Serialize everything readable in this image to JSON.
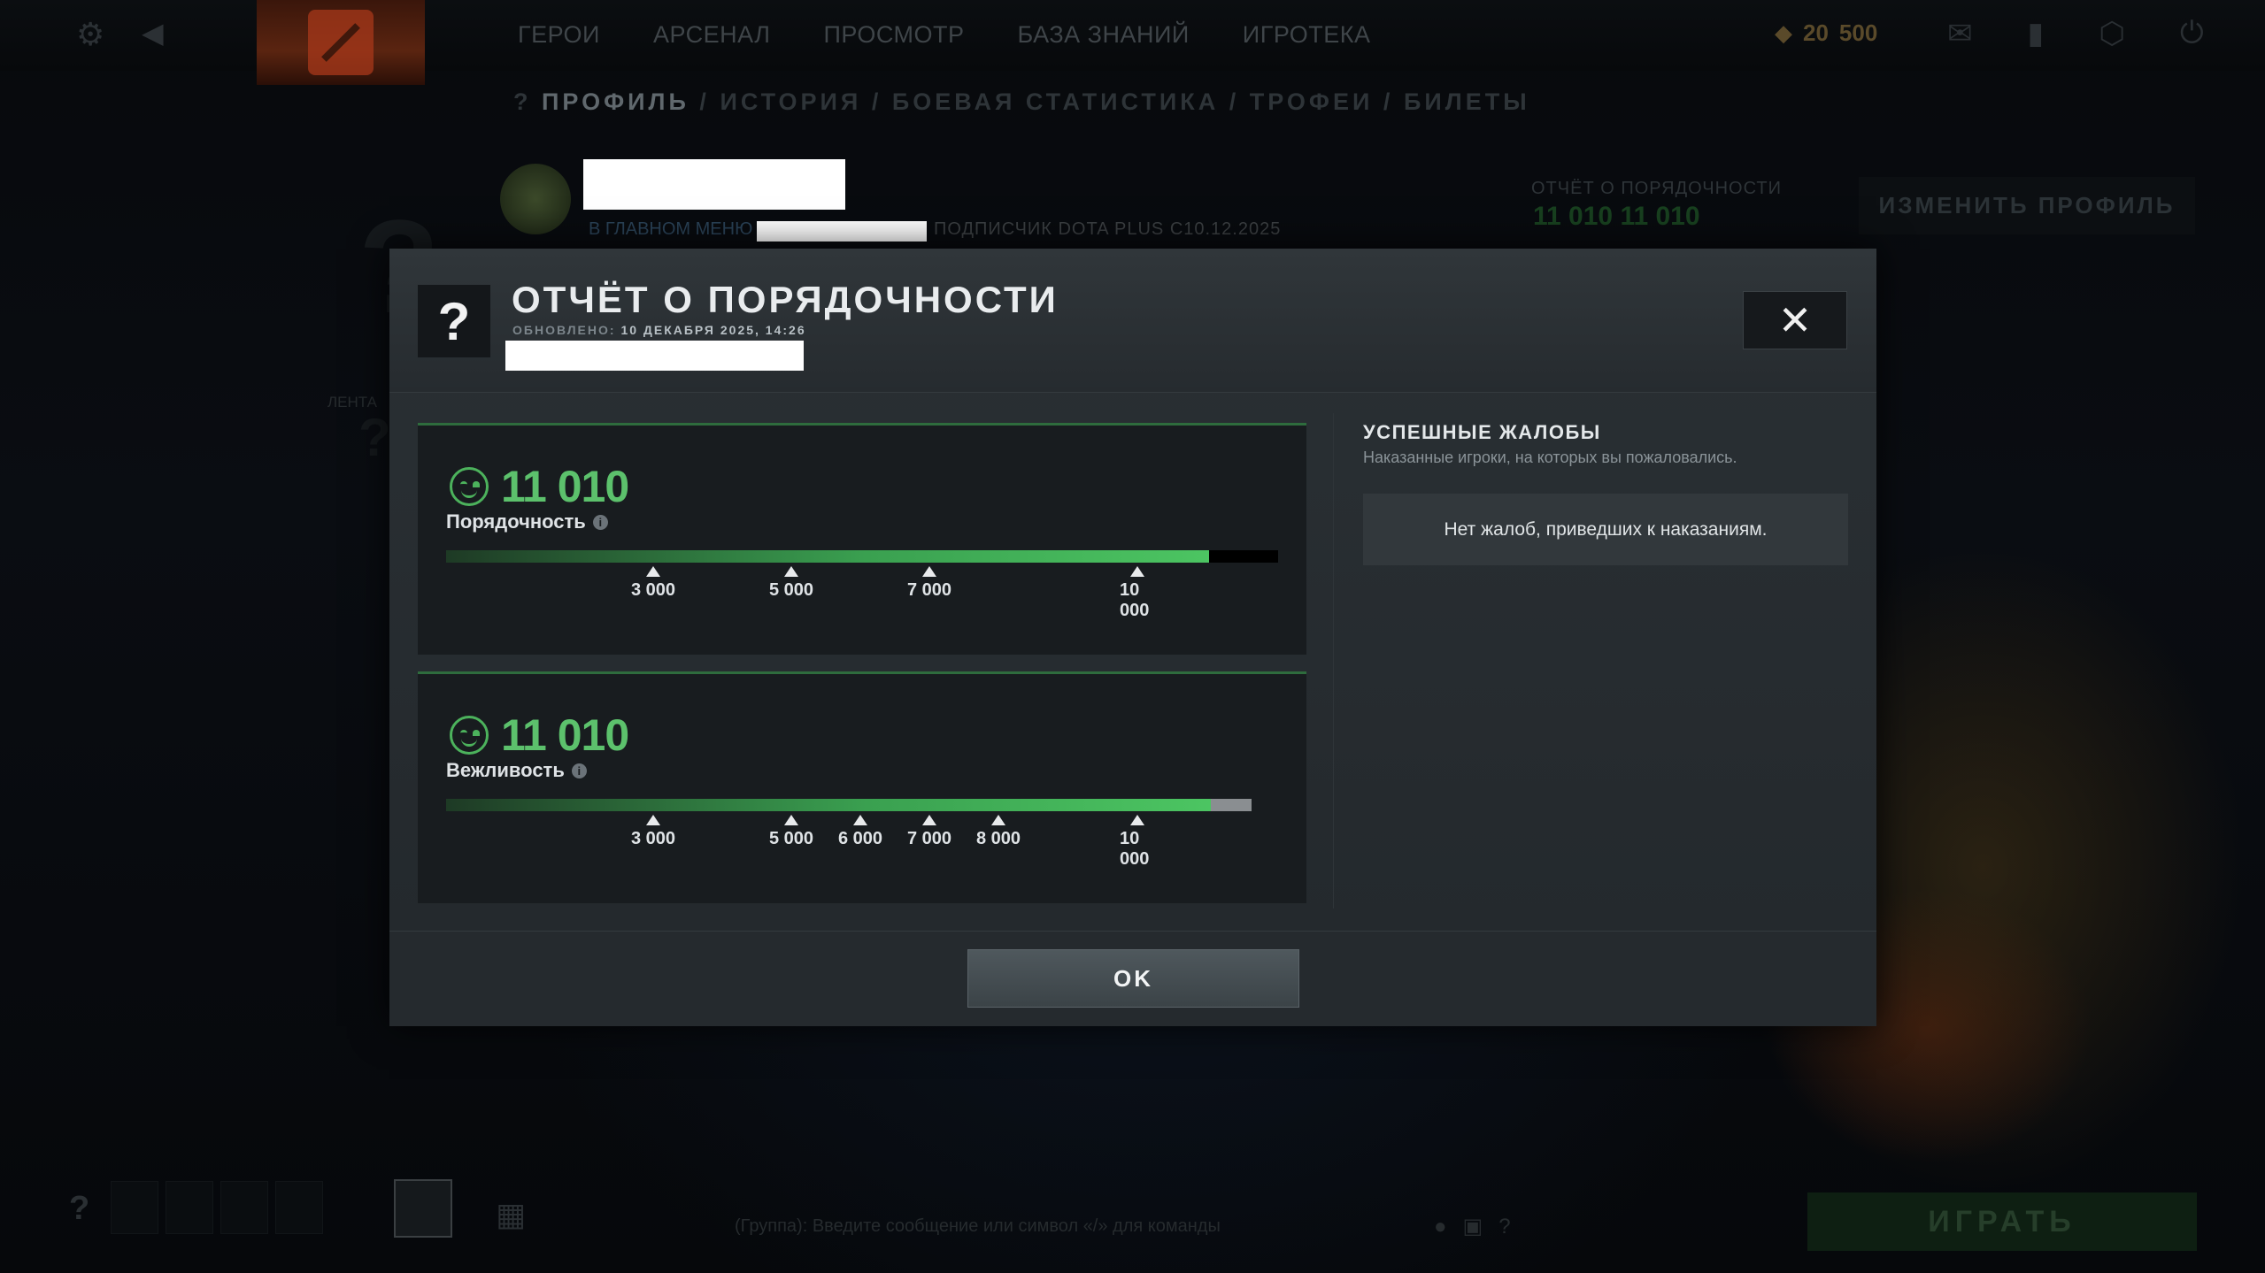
{
  "topbar": {
    "nav": [
      "ГЕРОИ",
      "АРСЕНАЛ",
      "ПРОСМОТР",
      "БАЗА ЗНАНИЙ",
      "ИГРОТЕКА"
    ],
    "currency_1": "20",
    "currency_2": "500"
  },
  "subnav": {
    "help": "?",
    "profile": "ПРОФИЛЬ",
    "history": "ИСТОРИЯ",
    "stats": "БОЕВАЯ СТАТИСТИКА",
    "trophies": "ТРОФЕИ",
    "tickets": "БИЛЕТЫ"
  },
  "profile": {
    "status": "В ГЛАВНОМ МЕНЮ",
    "subscription": "ПОДПИСЧИК DOTA PLUS",
    "since": "С10.12.2025",
    "conduct_label": "ОТЧЁТ О ПОРЯДОЧНОСТИ",
    "conduct_val_1": "11 010",
    "conduct_val_2": "11 010",
    "edit_button": "ИЗМЕНИТЬ ПРОФИЛЬ",
    "feed_label": "ЛЕНТА"
  },
  "modal": {
    "icon": "?",
    "title": "ОТЧЁТ О ПОРЯДОЧНОСТИ",
    "updated_label": "ОБНОВЛЕНО:",
    "updated_value": "10 ДЕКАБРЯ 2025, 14:26",
    "close": "✕",
    "ok_button": "OK"
  },
  "behavior": {
    "score": "11 010",
    "label": "Порядочность",
    "fill": 0.917,
    "track_color": "#000000",
    "ticks": [
      "3 000",
      "5 000",
      "7 000",
      "10 000"
    ]
  },
  "communication": {
    "score": "11 010",
    "label": "Вежливость",
    "fill": 0.949,
    "track_color": "#8a8e91",
    "ticks": [
      "3 000",
      "5 000",
      "6 000",
      "7 000",
      "8 000",
      "10 000"
    ]
  },
  "complaints": {
    "title": "УСПЕШНЫЕ ЖАЛОБЫ",
    "subtitle": "Наказанные игроки, на которых вы пожаловались.",
    "empty_text": "Нет жалоб, приведших к наказаниям."
  },
  "bottom": {
    "help": "?",
    "chat": "(Группа): Введите сообщение или символ «/» для команды",
    "play_button": "ИГРАТЬ"
  },
  "colors": {
    "accent_green": "#5cc16c",
    "modal_bg": "#262b2f"
  }
}
